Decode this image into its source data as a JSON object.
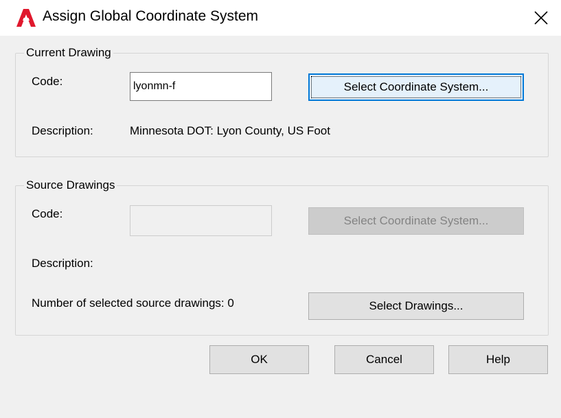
{
  "window": {
    "title": "Assign Global Coordinate System",
    "app_icon": "autocad-icon",
    "close_icon": "close-icon"
  },
  "current_drawing": {
    "group_label": "Current Drawing",
    "code_label": "Code:",
    "code_value": "lyonmn-f",
    "select_button": "Select Coordinate System...",
    "description_label": "Description:",
    "description_value": "Minnesota DOT: Lyon County, US Foot"
  },
  "source_drawings": {
    "group_label": "Source Drawings",
    "code_label": "Code:",
    "code_value": "",
    "select_button": "Select Coordinate System...",
    "description_label": "Description:",
    "count_label": "Number of selected source drawings: 0",
    "select_drawings_button": "Select Drawings..."
  },
  "footer": {
    "ok": "OK",
    "cancel": "Cancel",
    "help": "Help"
  },
  "colors": {
    "app_icon_red": "#e0182d",
    "dialog_bg": "#f0f0f0",
    "default_button_border": "#0078d7"
  }
}
